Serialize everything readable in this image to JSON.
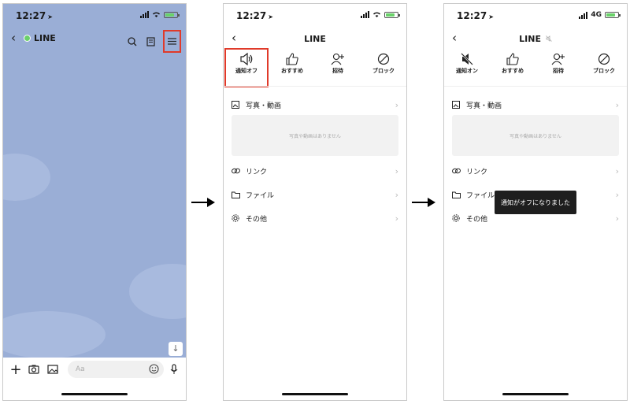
{
  "status": {
    "time": "12:27",
    "network": "4G"
  },
  "screen1": {
    "chat_title": "LINE",
    "input_placeholder": "Aa"
  },
  "screen2": {
    "title": "LINE",
    "actions": [
      {
        "label": "通知オフ",
        "icon": "speaker-icon"
      },
      {
        "label": "おすすめ",
        "icon": "thumbs-up-icon"
      },
      {
        "label": "招待",
        "icon": "add-person-icon"
      },
      {
        "label": "ブロック",
        "icon": "block-icon"
      }
    ],
    "menu": {
      "photos": "写真・動画",
      "photos_empty": "写真や動画はありません",
      "links": "リンク",
      "files": "ファイル",
      "other": "その他"
    }
  },
  "screen3": {
    "title": "LINE",
    "actions": [
      {
        "label": "通知オン",
        "icon": "muted-speaker-icon"
      },
      {
        "label": "おすすめ",
        "icon": "thumbs-up-icon"
      },
      {
        "label": "招待",
        "icon": "add-person-icon"
      },
      {
        "label": "ブロック",
        "icon": "block-icon"
      }
    ],
    "menu": {
      "photos": "写真・動画",
      "photos_empty": "写真や動画はありません",
      "links": "リンク",
      "files": "ファイル",
      "other": "その他"
    },
    "toast": "通知がオフになりました"
  },
  "colors": {
    "highlight": "#e03a2a",
    "chat_bg": "#9aaed6"
  }
}
